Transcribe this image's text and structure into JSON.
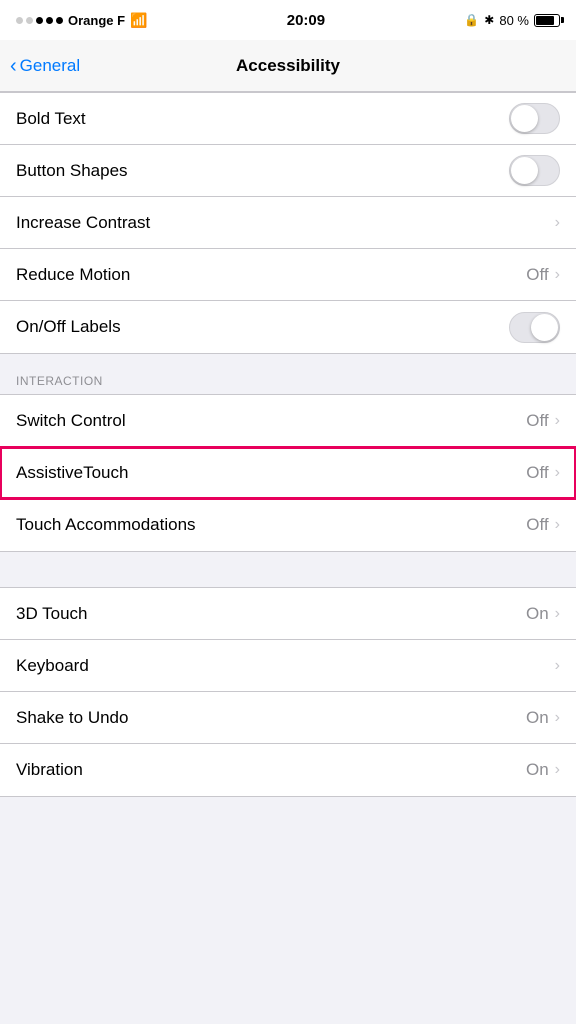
{
  "statusBar": {
    "carrier": "Orange F",
    "time": "20:09",
    "batteryPercent": "80 %"
  },
  "header": {
    "backLabel": "General",
    "title": "Accessibility"
  },
  "sections": [
    {
      "id": "vision",
      "header": null,
      "items": [
        {
          "id": "bold-text",
          "label": "Bold Text",
          "type": "toggle",
          "value": null,
          "valueText": null,
          "on": false
        },
        {
          "id": "button-shapes",
          "label": "Button Shapes",
          "type": "toggle",
          "value": null,
          "valueText": null,
          "on": false
        },
        {
          "id": "increase-contrast",
          "label": "Increase Contrast",
          "type": "chevron",
          "value": null,
          "valueText": null
        },
        {
          "id": "reduce-motion",
          "label": "Reduce Motion",
          "type": "chevron",
          "value": "Off",
          "valueText": "Off"
        },
        {
          "id": "onoff-labels",
          "label": "On/Off Labels",
          "type": "toggle-labels",
          "value": null,
          "valueText": null,
          "on": false
        }
      ]
    },
    {
      "id": "interaction",
      "header": "INTERACTION",
      "items": [
        {
          "id": "switch-control",
          "label": "Switch Control",
          "type": "chevron",
          "value": "Off",
          "valueText": "Off"
        },
        {
          "id": "assistivetouch",
          "label": "AssistiveTouch",
          "type": "chevron",
          "value": "Off",
          "valueText": "Off",
          "highlighted": true
        },
        {
          "id": "touch-accommodations",
          "label": "Touch Accommodations",
          "type": "chevron",
          "value": "Off",
          "valueText": "Off"
        }
      ]
    },
    {
      "id": "other",
      "header": null,
      "items": [
        {
          "id": "3d-touch",
          "label": "3D Touch",
          "type": "chevron",
          "value": "On",
          "valueText": "On"
        },
        {
          "id": "keyboard",
          "label": "Keyboard",
          "type": "chevron",
          "value": null,
          "valueText": null
        },
        {
          "id": "shake-to-undo",
          "label": "Shake to Undo",
          "type": "chevron",
          "value": "On",
          "valueText": "On"
        },
        {
          "id": "vibration",
          "label": "Vibration",
          "type": "chevron",
          "value": "On",
          "valueText": "On"
        }
      ]
    }
  ]
}
